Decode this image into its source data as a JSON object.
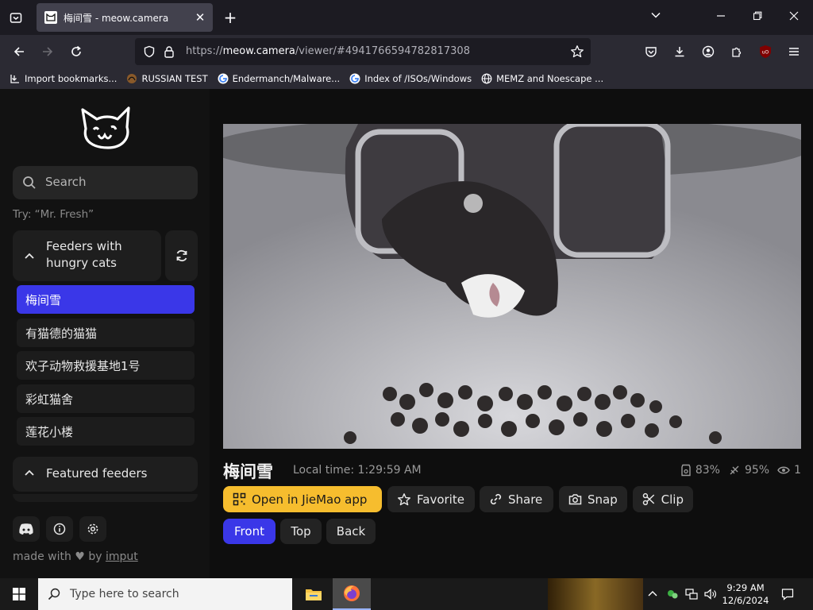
{
  "browser": {
    "tab_title": "梅间雪 - meow.camera",
    "url_scheme": "https://",
    "url_host": "meow.camera",
    "url_path": "/viewer/#4941766594782817308",
    "bookmarks": [
      {
        "label": "Import bookmarks...",
        "icon": "import-icon"
      },
      {
        "label": "RUSSIAN TEST",
        "icon": "globe-icon"
      },
      {
        "label": "Endermanch/Malware...",
        "icon": "google-icon"
      },
      {
        "label": "Index of /ISOs/Windows",
        "icon": "google-icon"
      },
      {
        "label": "MEMZ and Noescape ...",
        "icon": "globe-icon"
      }
    ]
  },
  "sidebar": {
    "search_placeholder": "Search",
    "hint": "Try: “Mr. Fresh”",
    "group1_title": "Feeders with hungry cats",
    "feeders": [
      "梅间雪",
      "有猫德的猫猫",
      "欢子动物救援基地1号",
      "彩虹猫舍",
      "莲花小楼"
    ],
    "group2_title": "Featured feeders",
    "footer_made_with": "made with",
    "footer_by": "by",
    "footer_link": "imput"
  },
  "viewer": {
    "cam_name": "梅间雪",
    "local_time": "Local time: 1:29:59 AM",
    "food_level": "83%",
    "battery_level": "95%",
    "viewers": "1",
    "actions": {
      "open_app": "Open in JieMao app",
      "favorite": "Favorite",
      "share": "Share",
      "snap": "Snap",
      "clip": "Clip"
    },
    "views": {
      "front": "Front",
      "top": "Top",
      "back": "Back"
    }
  },
  "taskbar": {
    "search_placeholder": "Type here to search",
    "time": "9:29 AM",
    "date": "12/6/2024"
  },
  "colors": {
    "accent": "#3a37e8",
    "app_button": "#f6bd2e"
  }
}
